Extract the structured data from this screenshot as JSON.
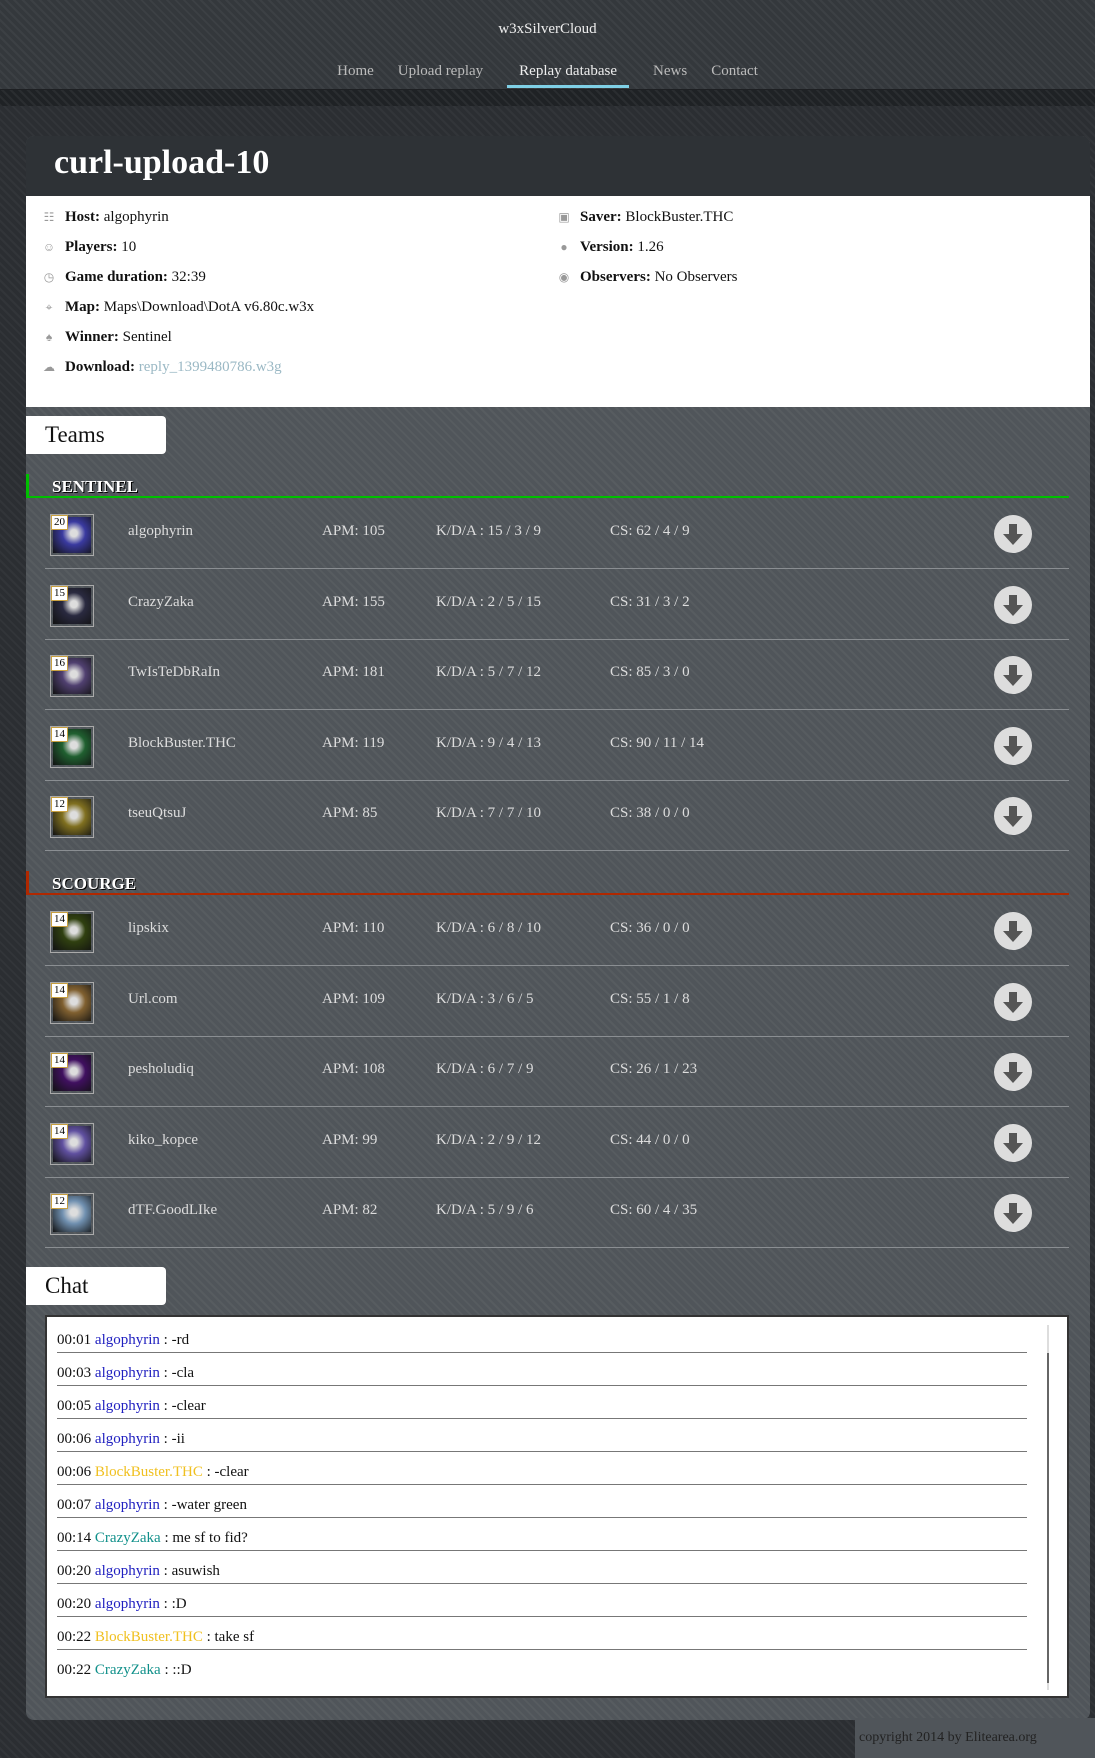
{
  "site": {
    "title": "w3xSilverCloud",
    "nav": [
      "Home",
      "Upload replay",
      "Replay database",
      "News",
      "Contact"
    ],
    "active_nav": "Replay database"
  },
  "page": {
    "title": "curl-upload-10"
  },
  "info": {
    "host_label": "Host:",
    "host": "algophyrin",
    "players_label": "Players:",
    "players": "10",
    "duration_label": "Game duration:",
    "duration": "32:39",
    "map_label": "Map:",
    "map": "Maps\\Download\\DotA v6.80c.w3x",
    "winner_label": "Winner:",
    "winner": "Sentinel",
    "download_label": "Download:",
    "download": "reply_1399480786.w3g",
    "saver_label": "Saver:",
    "saver": "BlockBuster.THC",
    "version_label": "Version:",
    "version": "1.26",
    "observers_label": "Observers:",
    "observers": "No Observers"
  },
  "teams_label": "Teams",
  "sentinel": {
    "name": "SENTINEL",
    "color": "#00c000",
    "players": [
      {
        "level": "20",
        "name": "algophyrin",
        "apm": "APM: 105",
        "kda": "K/D/A : 15 / 3 / 9",
        "cs": "CS: 62 / 4 / 9"
      },
      {
        "level": "15",
        "name": "CrazyZaka",
        "apm": "APM: 155",
        "kda": "K/D/A : 2 / 5 / 15",
        "cs": "CS: 31 / 3 / 2"
      },
      {
        "level": "16",
        "name": "TwIsTeDbRaIn",
        "apm": "APM: 181",
        "kda": "K/D/A : 5 / 7 / 12",
        "cs": "CS: 85 / 3 / 0"
      },
      {
        "level": "14",
        "name": "BlockBuster.THC",
        "apm": "APM: 119",
        "kda": "K/D/A : 9 / 4 / 13",
        "cs": "CS: 90 / 11 / 14"
      },
      {
        "level": "12",
        "name": "tseuQtsuJ",
        "apm": "APM: 85",
        "kda": "K/D/A : 7 / 7 / 10",
        "cs": "CS: 38 / 0 / 0"
      }
    ]
  },
  "scourge": {
    "name": "SCOURGE",
    "color": "#b02800",
    "players": [
      {
        "level": "14",
        "name": "lipskix",
        "apm": "APM: 110",
        "kda": "K/D/A : 6 / 8 / 10",
        "cs": "CS: 36 / 0 / 0"
      },
      {
        "level": "14",
        "name": "Url.com",
        "apm": "APM: 109",
        "kda": "K/D/A : 3 / 6 / 5",
        "cs": "CS: 55 / 1 / 8"
      },
      {
        "level": "14",
        "name": "pesholudiq",
        "apm": "APM: 108",
        "kda": "K/D/A : 6 / 7 / 9",
        "cs": "CS: 26 / 1 / 23"
      },
      {
        "level": "14",
        "name": "kiko_kopce",
        "apm": "APM: 99",
        "kda": "K/D/A : 2 / 9 / 12",
        "cs": "CS: 44 / 0 / 0"
      },
      {
        "level": "12",
        "name": "dTF.GoodLIke",
        "apm": "APM: 82",
        "kda": "K/D/A : 5 / 9 / 6",
        "cs": "CS: 60 / 4 / 35"
      }
    ]
  },
  "chat_label": "Chat",
  "chat": [
    {
      "time": "00:01",
      "name": "algophyrin",
      "msg": " : -rd",
      "color": "blue"
    },
    {
      "time": "00:03",
      "name": "algophyrin",
      "msg": " : -cla",
      "color": "blue"
    },
    {
      "time": "00:05",
      "name": "algophyrin",
      "msg": " : -clear",
      "color": "blue"
    },
    {
      "time": "00:06",
      "name": "algophyrin",
      "msg": " : -ii",
      "color": "blue"
    },
    {
      "time": "00:06",
      "name": "BlockBuster.THC",
      "msg": " : -clear",
      "color": "yel"
    },
    {
      "time": "00:07",
      "name": "algophyrin",
      "msg": " : -water green",
      "color": "blue"
    },
    {
      "time": "00:14",
      "name": "CrazyZaka",
      "msg": " : me sf to fid?",
      "color": "teal"
    },
    {
      "time": "00:20",
      "name": "algophyrin",
      "msg": " : asuwish",
      "color": "blue"
    },
    {
      "time": "00:20",
      "name": "algophyrin",
      "msg": " : :D",
      "color": "blue"
    },
    {
      "time": "00:22",
      "name": "BlockBuster.THC",
      "msg": " : take sf",
      "color": "yel"
    },
    {
      "time": "00:22",
      "name": "CrazyZaka",
      "msg": " : ::D",
      "color": "teal"
    }
  ],
  "footer": "copyright 2014 by Elitearea.org",
  "hero_colors": [
    "#3a3aa0",
    "#2a2a40",
    "#504070",
    "#206030",
    "#807020",
    "#304010",
    "#806030",
    "#401060",
    "#6050a0",
    "#7090b0"
  ]
}
